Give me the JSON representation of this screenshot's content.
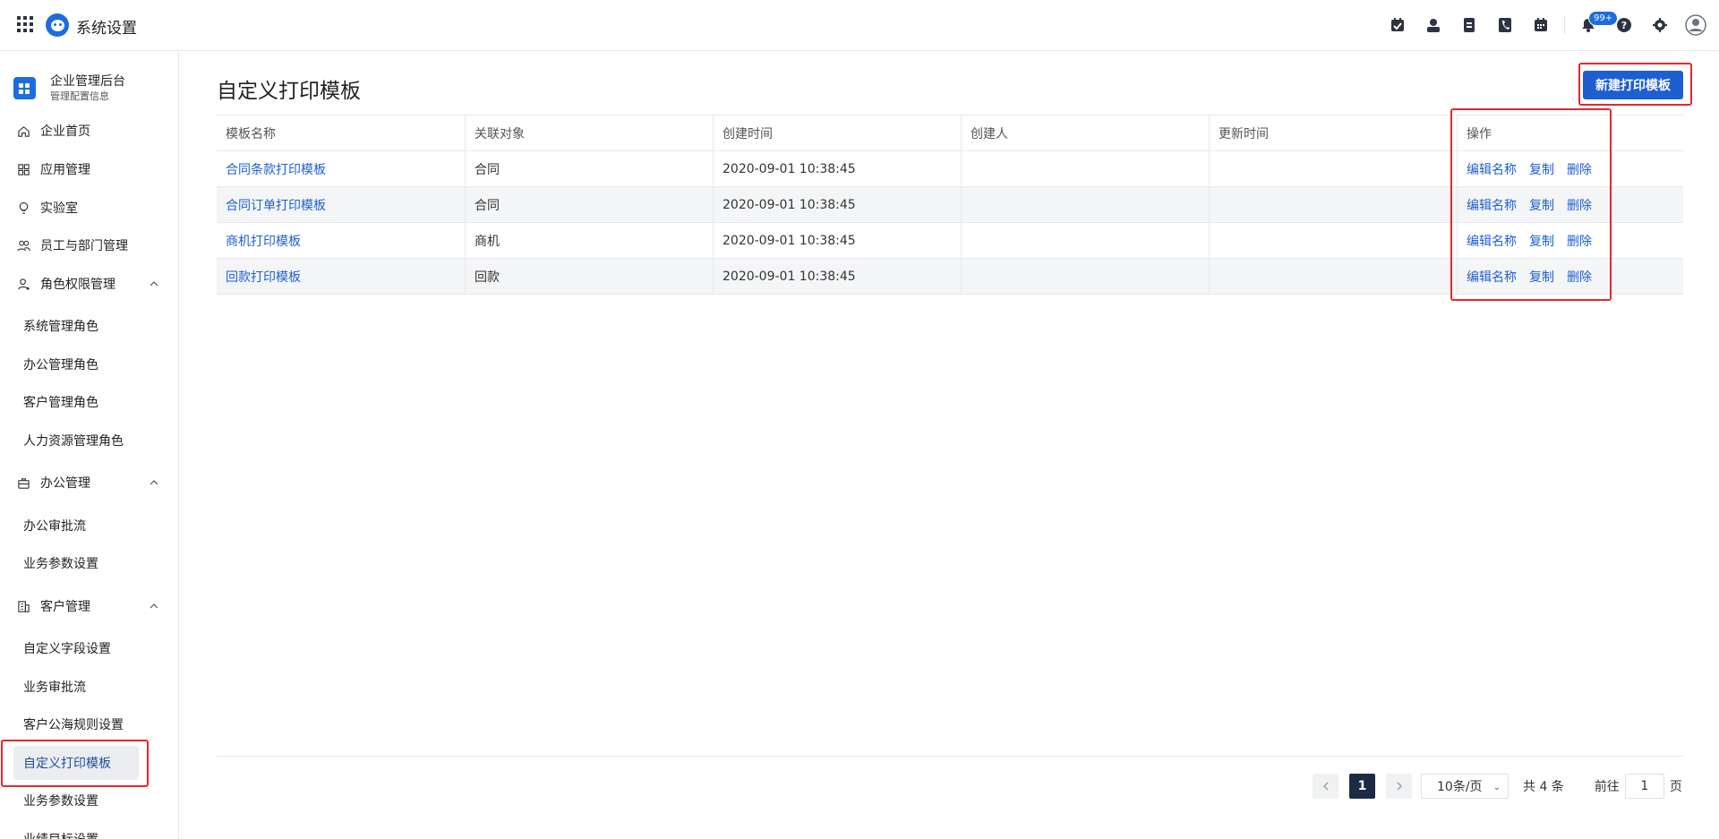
{
  "header": {
    "app_title": "系统设置",
    "notification_count": "99+",
    "tools": [
      "task-icon",
      "contacts-icon",
      "document-icon",
      "phone-icon",
      "calendar-icon",
      "bell-icon",
      "help-icon",
      "gear-icon",
      "user-avatar-icon"
    ]
  },
  "sidebar": {
    "org_name": "企业管理后台",
    "org_sub": "管理配置信息",
    "items": [
      {
        "label": "企业首页",
        "icon": "home-icon"
      },
      {
        "label": "应用管理",
        "icon": "apps-icon"
      },
      {
        "label": "实验室",
        "icon": "bulb-icon"
      },
      {
        "label": "员工与部门管理",
        "icon": "people-icon"
      },
      {
        "label": "角色权限管理",
        "icon": "role-icon"
      },
      {
        "label": "办公管理",
        "icon": "briefcase-icon"
      },
      {
        "label": "客户管理",
        "icon": "building-icon"
      }
    ],
    "role_subs": [
      "系统管理角色",
      "办公管理角色",
      "客户管理角色",
      "人力资源管理角色"
    ],
    "office_subs": [
      "办公审批流",
      "业务参数设置"
    ],
    "customer_subs": [
      "自定义字段设置",
      "业务审批流",
      "客户公海规则设置",
      "自定义打印模板",
      "业务参数设置",
      "业绩目标设置"
    ]
  },
  "main": {
    "title": "自定义打印模板",
    "new_button": "新建打印模板",
    "columns": [
      "模板名称",
      "关联对象",
      "创建时间",
      "创建人",
      "更新时间",
      "操作"
    ],
    "rows": [
      {
        "name": "合同条款打印模板",
        "object": "合同",
        "created": "2020-09-01 10:38:45",
        "creator": "",
        "updated": ""
      },
      {
        "name": "合同订单打印模板",
        "object": "合同",
        "created": "2020-09-01 10:38:45",
        "creator": "",
        "updated": ""
      },
      {
        "name": "商机打印模板",
        "object": "商机",
        "created": "2020-09-01 10:38:45",
        "creator": "",
        "updated": ""
      },
      {
        "name": "回款打印模板",
        "object": "回款",
        "created": "2020-09-01 10:38:45",
        "creator": "",
        "updated": ""
      }
    ],
    "ops": {
      "rename": "编辑名称",
      "copy": "复制",
      "delete": "删除"
    }
  },
  "pagination": {
    "current_page": "1",
    "page_size": "10条/页",
    "total": "共 4 条",
    "goto_prefix": "前往",
    "goto_value": "1",
    "goto_suffix": "页"
  },
  "colors": {
    "accent": "#1d5fd1",
    "highlight": "#e8262e",
    "active_page": "#1c2b44"
  }
}
